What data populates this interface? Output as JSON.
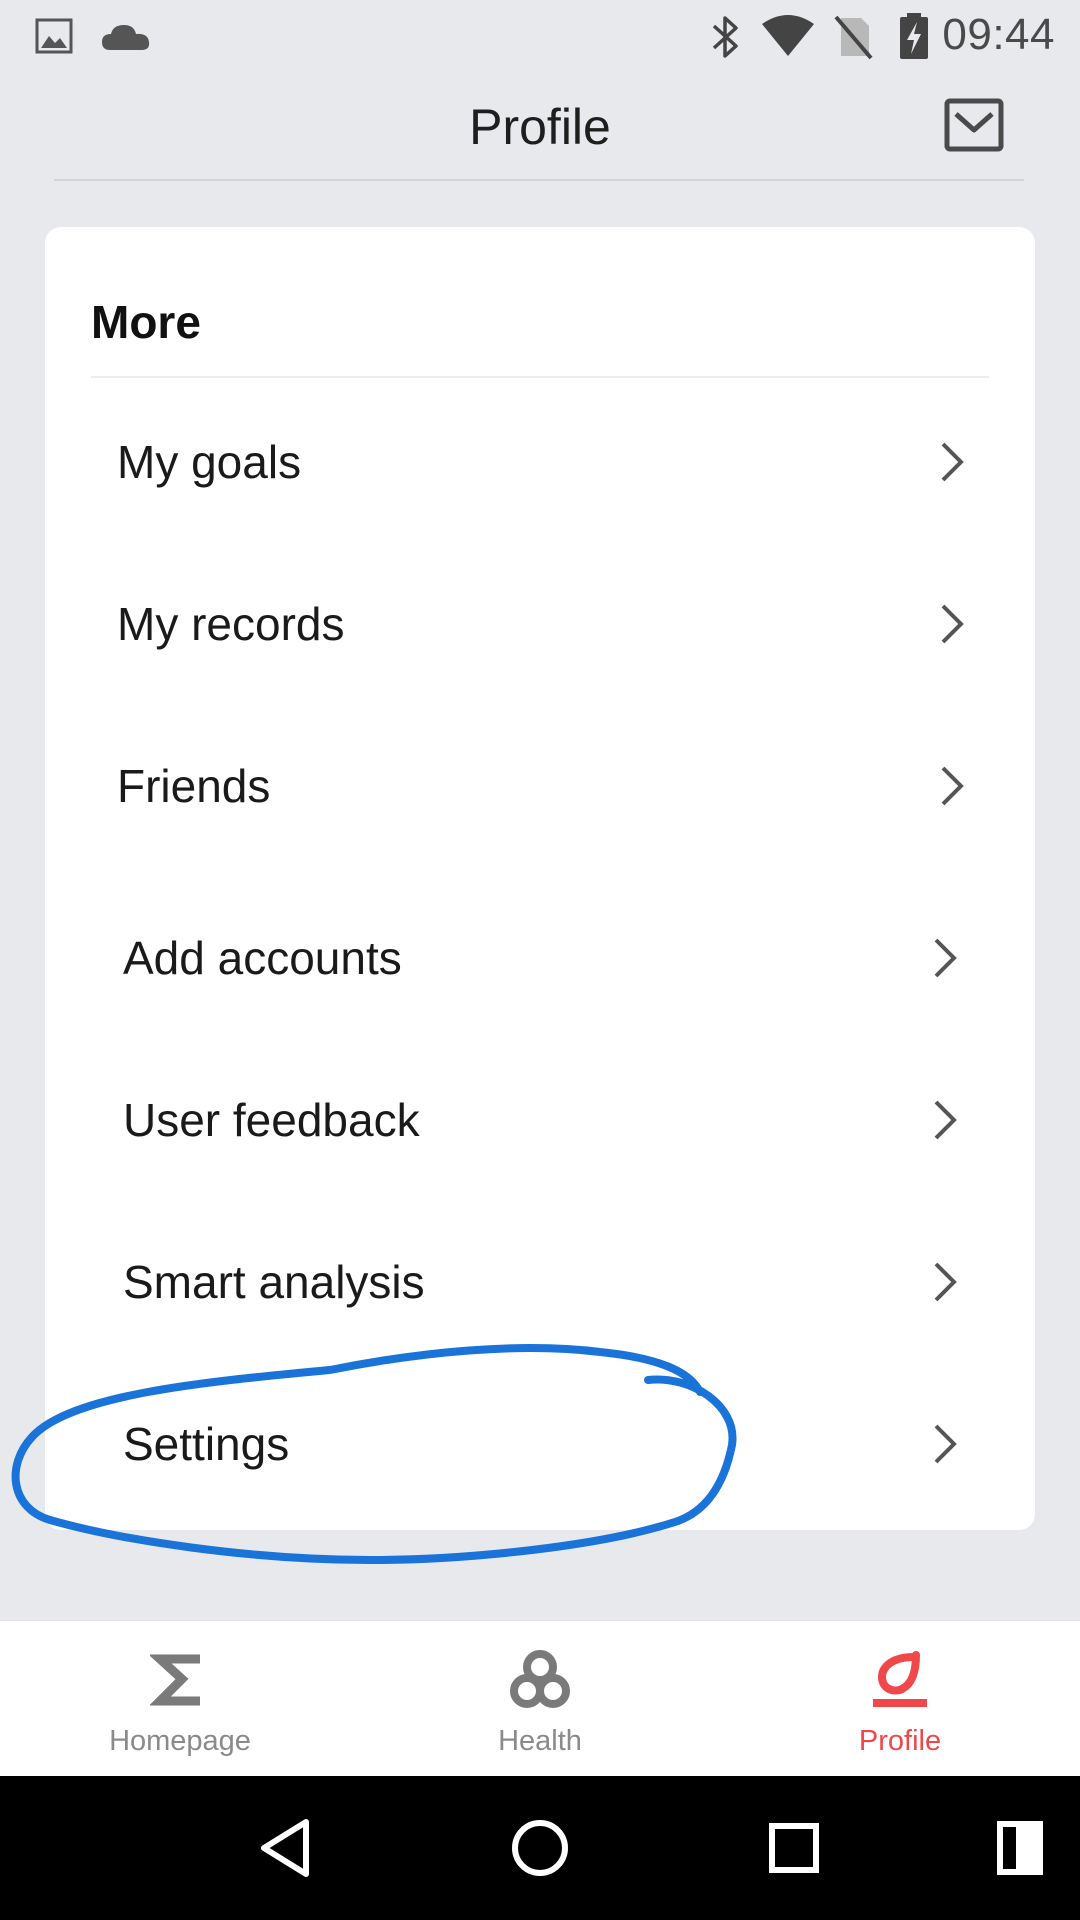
{
  "status_bar": {
    "time": "09:44",
    "left_icons": [
      "image-icon",
      "cloud-icon"
    ],
    "right_icons": [
      "bluetooth-icon",
      "wifi-icon",
      "no-sim-icon",
      "battery-charging-icon"
    ]
  },
  "header": {
    "title": "Profile",
    "mail_icon": "mail-icon"
  },
  "card": {
    "heading": "More",
    "items": [
      {
        "label": "My goals"
      },
      {
        "label": "My records"
      },
      {
        "label": "Friends"
      },
      {
        "label": "Add accounts"
      },
      {
        "label": "User feedback"
      },
      {
        "label": "Smart analysis"
      },
      {
        "label": "Settings"
      }
    ]
  },
  "bottom_nav": {
    "items": [
      {
        "label": "Homepage",
        "icon": "sigma-icon",
        "active": false
      },
      {
        "label": "Health",
        "icon": "health-icon",
        "active": false
      },
      {
        "label": "Profile",
        "icon": "profile-icon",
        "active": true
      }
    ]
  },
  "colors": {
    "accent": "#f0484a",
    "background": "#e8e9ed",
    "annotation": "#1a73d9"
  },
  "system_nav": {
    "buttons": [
      "back-icon",
      "home-icon",
      "recents-icon",
      "split-screen-icon"
    ]
  }
}
